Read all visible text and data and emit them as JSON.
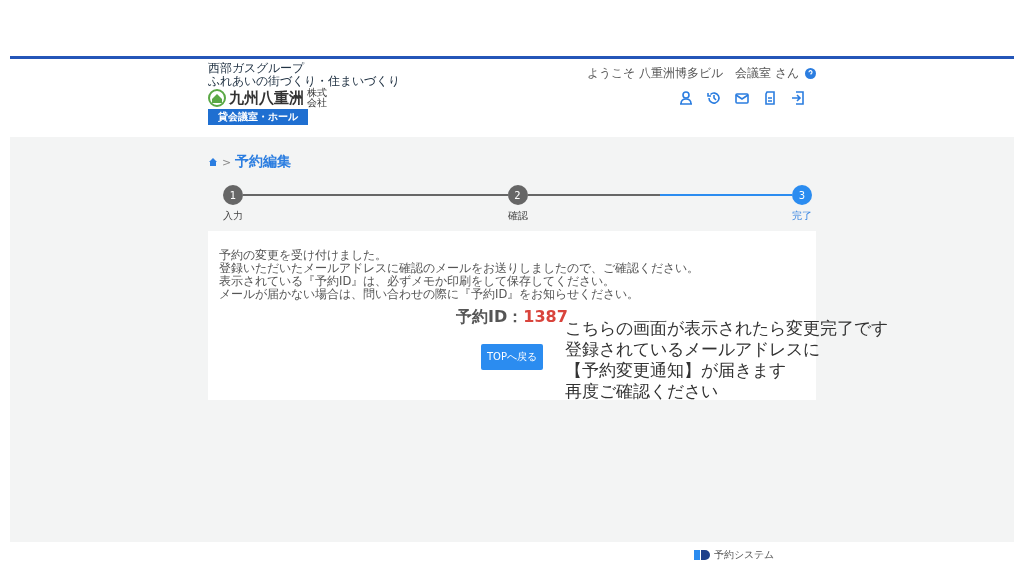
{
  "header": {
    "logo": {
      "group": "西部ガスグループ",
      "slogan": "ふれあいの街づくり・住まいづくり",
      "company": "九州八重洲",
      "company_suffix": "株式会社",
      "badge": "貸会議室・ホール"
    },
    "welcome": "ようこそ 八重洲博多ビル　会議室 さん"
  },
  "breadcrumb": {
    "separator": ">",
    "title": "予約編集"
  },
  "steps": [
    {
      "number": "1",
      "label": "入力",
      "selected": false
    },
    {
      "number": "2",
      "label": "確認",
      "selected": false
    },
    {
      "number": "3",
      "label": "完了",
      "selected": true
    }
  ],
  "message": [
    "予約の変更を受け付けました。",
    "登録いただいたメールアドレスに確認のメールをお送りしましたので、ご確認ください。",
    "表示されている『予約ID』は、必ずメモか印刷をして保存してください。",
    "メールが届かない場合は、問い合わせの際に『予約ID』をお知らせください。"
  ],
  "reservation": {
    "label": "予約ID：",
    "value": "1387"
  },
  "top_button": "TOPへ戻る",
  "footer": {
    "system": "予約システム"
  },
  "annotation": [
    "こちらの画面が表示されたら変更完了です",
    "登録されているメールアドレスに",
    "【予約変更通知】が届きます",
    "再度ご確認ください"
  ]
}
